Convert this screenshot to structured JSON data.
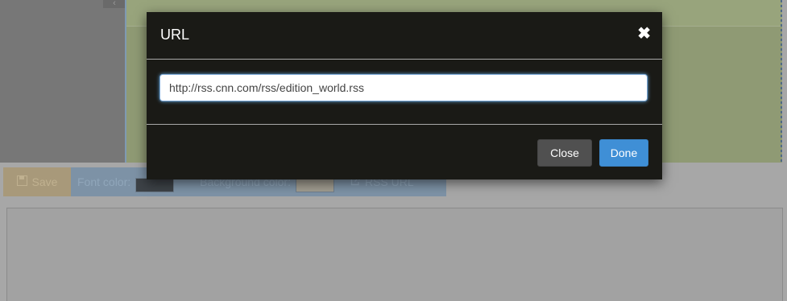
{
  "modal": {
    "title": "URL",
    "close_icon": "close-icon",
    "url_value": "http://rss.cnn.com/rss/edition_world.rss",
    "close_label": "Close",
    "done_label": "Done"
  },
  "toolbar": {
    "save_label": "Save",
    "save_icon": "save-icon",
    "font_color_label": "Font color:",
    "background_color_label": "Background color:",
    "rss_url_label": "RSS URL",
    "rss_icon": "external-link-icon"
  },
  "colors": {
    "primary": "#3f8fd6",
    "modal_bg": "#1a1a16",
    "font_color_swatch": "#3d4247",
    "background_color_swatch": "#a09c90"
  }
}
